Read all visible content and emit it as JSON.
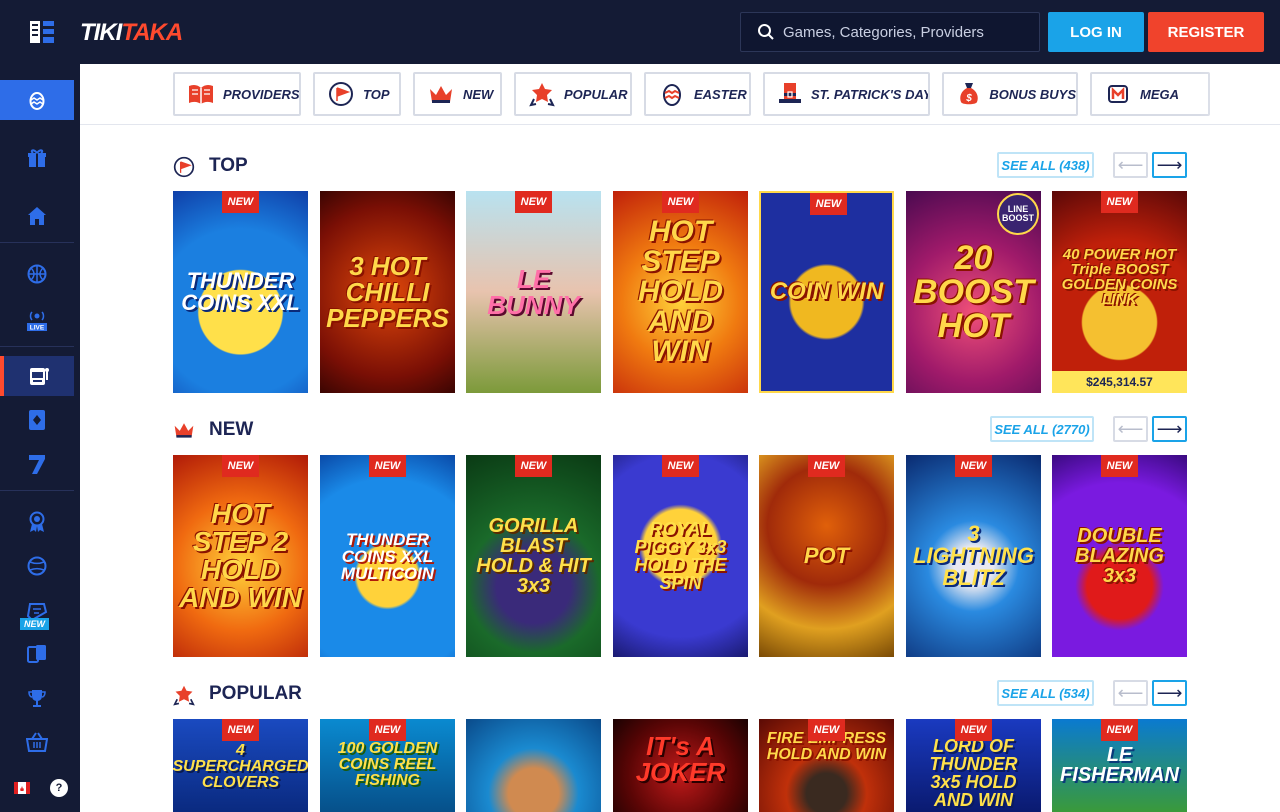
{
  "header": {
    "logo_part1": "TIKI",
    "logo_part2": "TAKA",
    "search_placeholder": "Games, Categories, Providers",
    "login_label": "LOG IN",
    "register_label": "REGISTER"
  },
  "sidebar": {
    "new_tag": "NEW",
    "help": "?"
  },
  "categories": [
    {
      "label": "PROVIDERS",
      "icon": "book-icon"
    },
    {
      "label": "TOP",
      "icon": "top-flag-icon"
    },
    {
      "label": "NEW",
      "icon": "crown-icon"
    },
    {
      "label": "POPULAR",
      "icon": "star-badge-icon"
    },
    {
      "label": "EASTER",
      "icon": "easter-egg-icon"
    },
    {
      "label": "ST. PATRICK'S DAY",
      "icon": "leprechaun-hat-icon"
    },
    {
      "label": "BONUS BUYS",
      "icon": "money-bag-icon"
    },
    {
      "label": "MEGA",
      "icon": "mega-icon"
    }
  ],
  "sections": [
    {
      "title": "TOP",
      "see_all": "SEE ALL (438)",
      "games": [
        {
          "name": "THUNDER COINS XXL",
          "badge": "NEW"
        },
        {
          "name": "3 HOT CHILLI PEPPERS",
          "badge": ""
        },
        {
          "name": "LE BUNNY",
          "badge": "NEW"
        },
        {
          "name": "HOT STEP HOLD AND WIN",
          "badge": "NEW"
        },
        {
          "name": "COIN WIN",
          "badge": "NEW"
        },
        {
          "name": "20 BOOST HOT",
          "badge": "",
          "boost": "LINE BOOST"
        },
        {
          "name": "40 POWER HOT Triple BOOST GOLDEN COINS LINK",
          "badge": "NEW",
          "jackpot": "$245,314.57"
        }
      ]
    },
    {
      "title": "NEW",
      "see_all": "SEE ALL (2770)",
      "games": [
        {
          "name": "HOT STEP 2 HOLD AND WIN",
          "badge": "NEW"
        },
        {
          "name": "THUNDER COINS XXL MULTICOIN",
          "badge": "NEW"
        },
        {
          "name": "GORILLA BLAST HOLD & HIT 3x3",
          "badge": "NEW"
        },
        {
          "name": "ROYAL PIGGY 3x3 HOLD THE SPIN",
          "badge": "NEW"
        },
        {
          "name": "POT",
          "badge": "NEW"
        },
        {
          "name": "3 LIGHTNING BLITZ",
          "badge": "NEW"
        },
        {
          "name": "DOUBLE BLAZING 3x3",
          "badge": "NEW"
        }
      ]
    },
    {
      "title": "POPULAR",
      "see_all": "SEE ALL (534)",
      "games": [
        {
          "name": "4 SUPERCHARGED CLOVERS",
          "badge": "NEW"
        },
        {
          "name": "100 GOLDEN COINS REEL FISHING",
          "badge": "NEW"
        },
        {
          "name": "",
          "badge": ""
        },
        {
          "name": "IT's A JOKER",
          "badge": ""
        },
        {
          "name": "FIRE EMPRESS HOLD AND WIN",
          "badge": "NEW"
        },
        {
          "name": "LORD OF THUNDER 3x5 HOLD AND WIN",
          "badge": "NEW"
        },
        {
          "name": "LE FISHERMAN",
          "badge": "NEW"
        }
      ]
    }
  ],
  "colors": {
    "topbar": "#141b35",
    "login": "#1aa3e8",
    "register": "#f0432c",
    "badge": "#e02a1f",
    "title": "#1d2554"
  }
}
